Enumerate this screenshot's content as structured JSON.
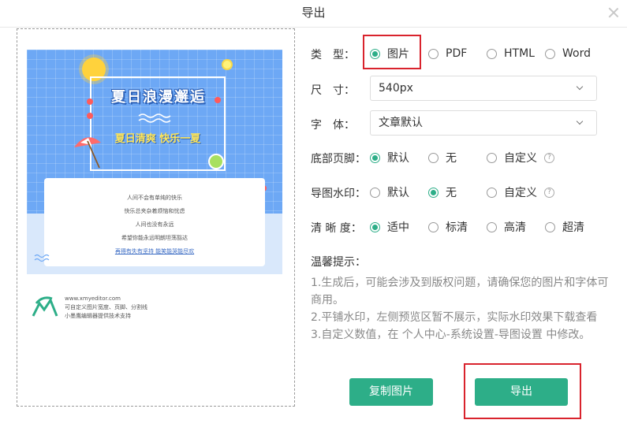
{
  "dialog": {
    "title": "导出"
  },
  "preview": {
    "poster_title": "夏日浪漫邂逅",
    "poster_subtitle": "夏日清爽 快乐一夏",
    "card_lines": [
      "人间不会有单纯的快乐",
      "快乐总夹杂着烦恼和忧虑",
      "人间也没有永远",
      "希望你能永远明朗坦荡豁达",
      "再得有失有坚持 能笑能哭能尽欢"
    ],
    "brand": {
      "site": "www.xmyeditor.com",
      "line1": "可自定义图片宽度、页脚、分割线",
      "line2": "小墨鹰编辑器提供技术支持"
    }
  },
  "form": {
    "type": {
      "label": "类　型：",
      "options": [
        "图片",
        "PDF",
        "HTML",
        "Word"
      ],
      "selected": "图片"
    },
    "size": {
      "label": "尺　寸：",
      "value": "540px"
    },
    "font": {
      "label": "字　体：",
      "value": "文章默认"
    },
    "footer": {
      "label": "底部页脚：",
      "options": [
        "默认",
        "无",
        "自定义"
      ],
      "selected": "默认",
      "help": "?"
    },
    "watermark": {
      "label": "导图水印：",
      "options": [
        "默认",
        "无",
        "自定义"
      ],
      "selected": "无",
      "help": "?"
    },
    "clarity": {
      "label": "清 晰 度：",
      "options": [
        "适中",
        "标清",
        "高清",
        "超清"
      ],
      "selected": "适中"
    }
  },
  "tips": {
    "title": "温馨提示：",
    "items": [
      "1.生成后，可能会涉及到版权问题，请确保您的图片和字体可商用。",
      "2.平铺水印，左侧预览区暂不展示，实际水印效果下载查看",
      "3.自定义数值，在 个人中心-系统设置-导图设置 中修改。"
    ]
  },
  "buttons": {
    "copy": "复制图片",
    "export": "导出"
  },
  "colors": {
    "accent": "#2dae88",
    "highlight": "#d9232d",
    "poster_blue": "#6da8f5"
  }
}
